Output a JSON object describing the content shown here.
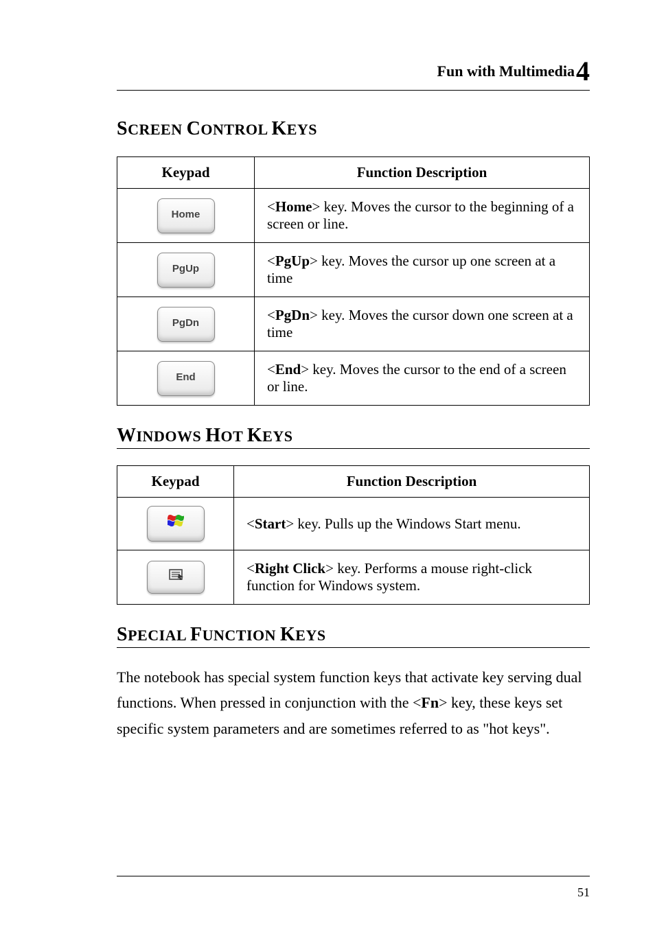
{
  "header": {
    "title": "Fun with Multimedia",
    "chapter": "4"
  },
  "sections": {
    "screen": {
      "heading_parts": [
        "S",
        "CREEN ",
        "C",
        "ONTROL ",
        "K",
        "EYS"
      ],
      "cols": {
        "keypad": "Keypad",
        "desc": "Function Description"
      },
      "rows": [
        {
          "key": "Home",
          "bold": "Home",
          "text": "> key. Moves the cursor to the beginning of a screen or line."
        },
        {
          "key": "PgUp",
          "bold": "PgUp",
          "text": "> key. Moves the cursor up one screen at a time"
        },
        {
          "key": "PgDn",
          "bold": "PgDn",
          "text": "> key. Moves the cursor down one screen at a time"
        },
        {
          "key": "End",
          "bold": "End",
          "text": "> key. Moves the cursor to the end of a screen or line."
        }
      ]
    },
    "windows": {
      "heading_parts": [
        "W",
        "INDOWS ",
        "H",
        "OT ",
        "K",
        "EYS"
      ],
      "cols": {
        "keypad": "Keypad",
        "desc": "Function Description"
      },
      "rows": [
        {
          "icon": "windows-logo",
          "bold": "Start",
          "text": "> key. Pulls up the Windows Start menu."
        },
        {
          "icon": "context-menu",
          "bold": "Right Click",
          "text": "> key. Performs a mouse right-click function for Windows system."
        }
      ]
    },
    "special": {
      "heading_parts": [
        "S",
        "PECIAL ",
        "F",
        "UNCTION ",
        "K",
        "EYS"
      ],
      "body_pre": "The notebook has special system function keys that activate key serving dual functions. When pressed in conjunction with the <",
      "body_bold": "Fn",
      "body_post": "> key, these keys set specific system parameters and are sometimes referred to as \"hot keys\"."
    }
  },
  "footer": {
    "page": "51"
  }
}
